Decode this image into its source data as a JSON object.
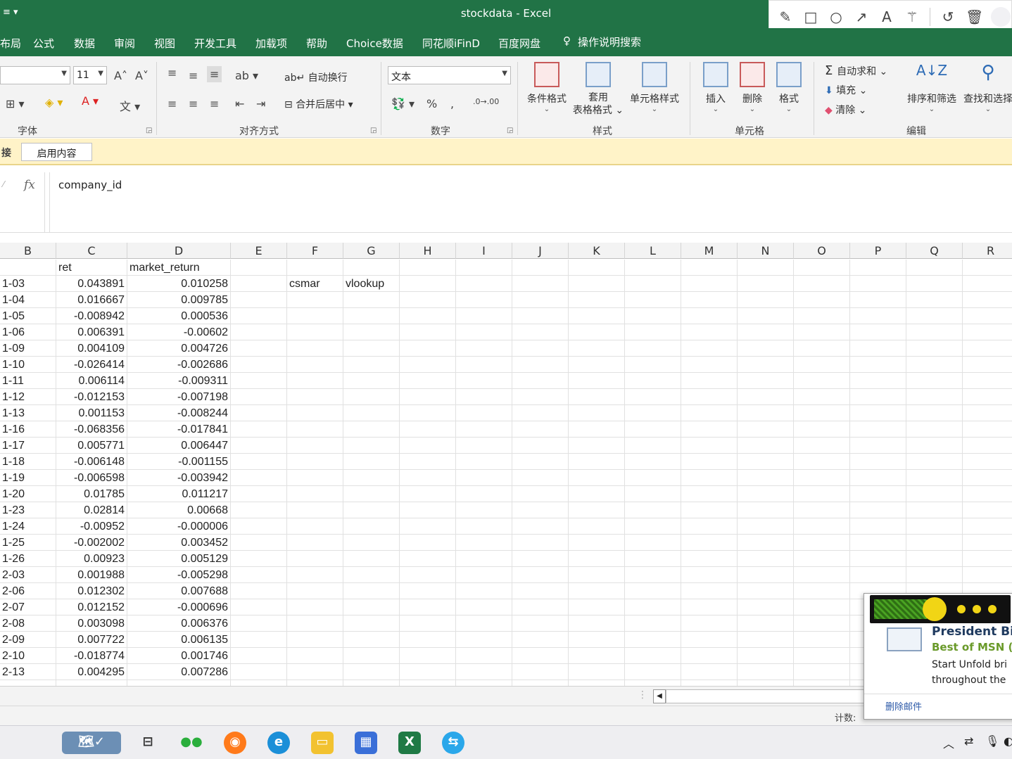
{
  "title": {
    "app_title": "stockdata  -  Excel",
    "qat": "≡  ▾"
  },
  "menu_tabs": [
    "布局",
    "公式",
    "数据",
    "审阅",
    "视图",
    "开发工具",
    "加载项",
    "帮助",
    "Choice数据",
    "同花顺iFinD",
    "百度网盘"
  ],
  "tell_me": "操作说明搜索",
  "ribbon": {
    "font_size": "11",
    "wrap_text": "自动换行",
    "merge_center": "合并后居中",
    "number_format": "文本",
    "cond_format": "条件格式",
    "table_format": "套用\n表格格式",
    "cell_style": "单元格样式",
    "insert": "插入",
    "delete": "删除",
    "format": "格式",
    "autosum": "自动求和",
    "fill": "填充",
    "clear": "清除",
    "sort_filter": "排序和筛选",
    "find_select": "查找和选择",
    "groups": {
      "font": "字体",
      "alignment": "对齐方式",
      "number": "数字",
      "styles": "样式",
      "cells": "单元格",
      "editing": "编辑"
    }
  },
  "message_bar": {
    "label": "接",
    "button": "启用内容"
  },
  "formula_bar": {
    "fx": "fx",
    "content": "company_id"
  },
  "columns": [
    "B",
    "C",
    "D",
    "E",
    "F",
    "G",
    "H",
    "I",
    "J",
    "K",
    "L",
    "M",
    "N",
    "O",
    "P",
    "Q",
    "R"
  ],
  "header_row": {
    "C": "ret",
    "D": "market_return"
  },
  "extra_cells": {
    "F": "csmar",
    "G": "vlookup"
  },
  "rows": [
    {
      "date": "1-03",
      "ret": "0.043891",
      "mkt": "0.010258"
    },
    {
      "date": "1-04",
      "ret": "0.016667",
      "mkt": "0.009785"
    },
    {
      "date": "1-05",
      "ret": "-0.008942",
      "mkt": "0.000536"
    },
    {
      "date": "1-06",
      "ret": "0.006391",
      "mkt": "-0.00602"
    },
    {
      "date": "1-09",
      "ret": "0.004109",
      "mkt": "0.004726"
    },
    {
      "date": "1-10",
      "ret": "-0.026414",
      "mkt": "-0.002686"
    },
    {
      "date": "1-11",
      "ret": "0.006114",
      "mkt": "-0.009311"
    },
    {
      "date": "1-12",
      "ret": "-0.012153",
      "mkt": "-0.007198"
    },
    {
      "date": "1-13",
      "ret": "0.001153",
      "mkt": "-0.008244"
    },
    {
      "date": "1-16",
      "ret": "-0.068356",
      "mkt": "-0.017841"
    },
    {
      "date": "1-17",
      "ret": "0.005771",
      "mkt": "0.006447"
    },
    {
      "date": "1-18",
      "ret": "-0.006148",
      "mkt": "-0.001155"
    },
    {
      "date": "1-19",
      "ret": "-0.006598",
      "mkt": "-0.003942"
    },
    {
      "date": "1-20",
      "ret": "0.01785",
      "mkt": "0.011217"
    },
    {
      "date": "1-23",
      "ret": "0.02814",
      "mkt": "0.00668"
    },
    {
      "date": "1-24",
      "ret": "-0.00952",
      "mkt": "-0.000006"
    },
    {
      "date": "1-25",
      "ret": "-0.002002",
      "mkt": "0.003452"
    },
    {
      "date": "1-26",
      "ret": "0.00923",
      "mkt": "0.005129"
    },
    {
      "date": "2-03",
      "ret": "0.001988",
      "mkt": "-0.005298"
    },
    {
      "date": "2-06",
      "ret": "0.012302",
      "mkt": "0.007688"
    },
    {
      "date": "2-07",
      "ret": "0.012152",
      "mkt": "-0.000696"
    },
    {
      "date": "2-08",
      "ret": "0.003098",
      "mkt": "0.006376"
    },
    {
      "date": "2-09",
      "ret": "0.007722",
      "mkt": "0.006135"
    },
    {
      "date": "2-10",
      "ret": "-0.018774",
      "mkt": "0.001746"
    },
    {
      "date": "2-13",
      "ret": "0.004295",
      "mkt": "0.007286"
    }
  ],
  "status": {
    "count_label": "计数:"
  },
  "notification": {
    "title": "President Bic",
    "subtitle": "Best of MSN (S",
    "body_line1": "Start Unfold bri",
    "body_line2": "throughout the",
    "delete_link": "删除邮件",
    "loading_progress": 0.4
  },
  "colors": {
    "excel_green": "#217346",
    "ribbon_bg": "#f3f3f3",
    "message_bar": "#fff3c8"
  }
}
